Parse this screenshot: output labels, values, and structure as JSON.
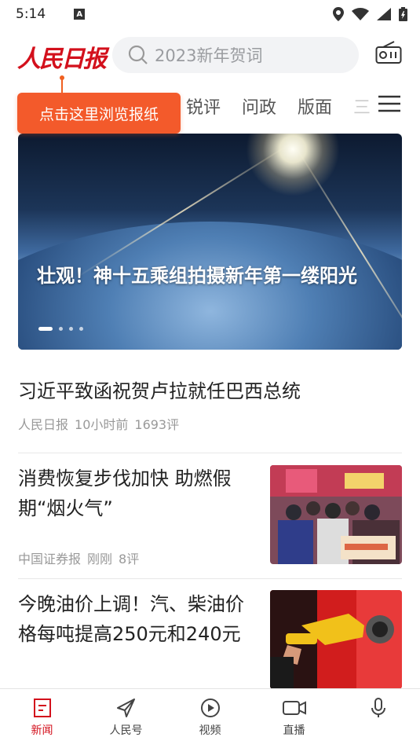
{
  "status": {
    "time": "5:14",
    "notification_icon": "A"
  },
  "header": {
    "logo": "人民日报",
    "search_placeholder": "2023新年贺词"
  },
  "tooltip": "点击这里浏览报纸",
  "tabs": [
    "锐评",
    "问政",
    "版面",
    "三"
  ],
  "hero": {
    "title": "壮观！神十五乘组拍摄新年第一缕阳光"
  },
  "articles": [
    {
      "title": "习近平致函祝贺卢拉就任巴西总统",
      "source": "人民日报",
      "time": "10小时前",
      "comments": "1693评"
    },
    {
      "title": "消费恢复步伐加快 助燃假期“烟火气”",
      "source": "中国证券报",
      "time": "刚刚",
      "comments": "8评"
    },
    {
      "title": "今晚油价上调！汽、柴油价格每吨提高250元和240元"
    }
  ],
  "bottom_nav": [
    {
      "label": "新闻",
      "icon": "news-icon"
    },
    {
      "label": "人民号",
      "icon": "paper-plane-icon"
    },
    {
      "label": "视频",
      "icon": "play-icon"
    },
    {
      "label": "直播",
      "icon": "camera-icon"
    },
    {
      "label": "",
      "icon": "microphone-icon"
    }
  ],
  "colors": {
    "brand": "#d3101c",
    "tooltip": "#f35a2b"
  }
}
